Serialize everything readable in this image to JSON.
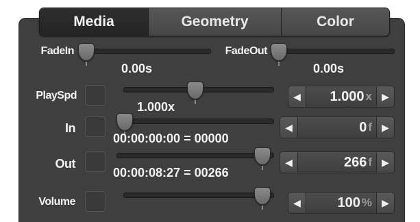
{
  "tabs": [
    {
      "label": "Media",
      "active": true
    },
    {
      "label": "Geometry",
      "active": false
    },
    {
      "label": "Color",
      "active": false
    }
  ],
  "fade": {
    "fadein_label": "FadeIn",
    "fadein_value": "0.00s",
    "fadeout_label": "FadeOut",
    "fadeout_value": "0.00s"
  },
  "rows": {
    "playspd": {
      "label": "PlaySpd",
      "slider_text": "1.000x",
      "spin_value": "1.000",
      "spin_unit": "x"
    },
    "in": {
      "label": "In",
      "slider_text": "00:00:00:00 = 00000",
      "spin_value": "0",
      "spin_unit": "f"
    },
    "out": {
      "label": "Out",
      "slider_text": "00:00:08:27 = 00266",
      "spin_value": "266",
      "spin_unit": "f"
    },
    "volume": {
      "label": "Volume",
      "spin_value": "100",
      "spin_unit": "%"
    }
  },
  "icons": {
    "left_arrow": "◀",
    "right_arrow": "▶"
  },
  "colors": {
    "panel": "#3f3f3f",
    "active_tab": "#242424"
  }
}
